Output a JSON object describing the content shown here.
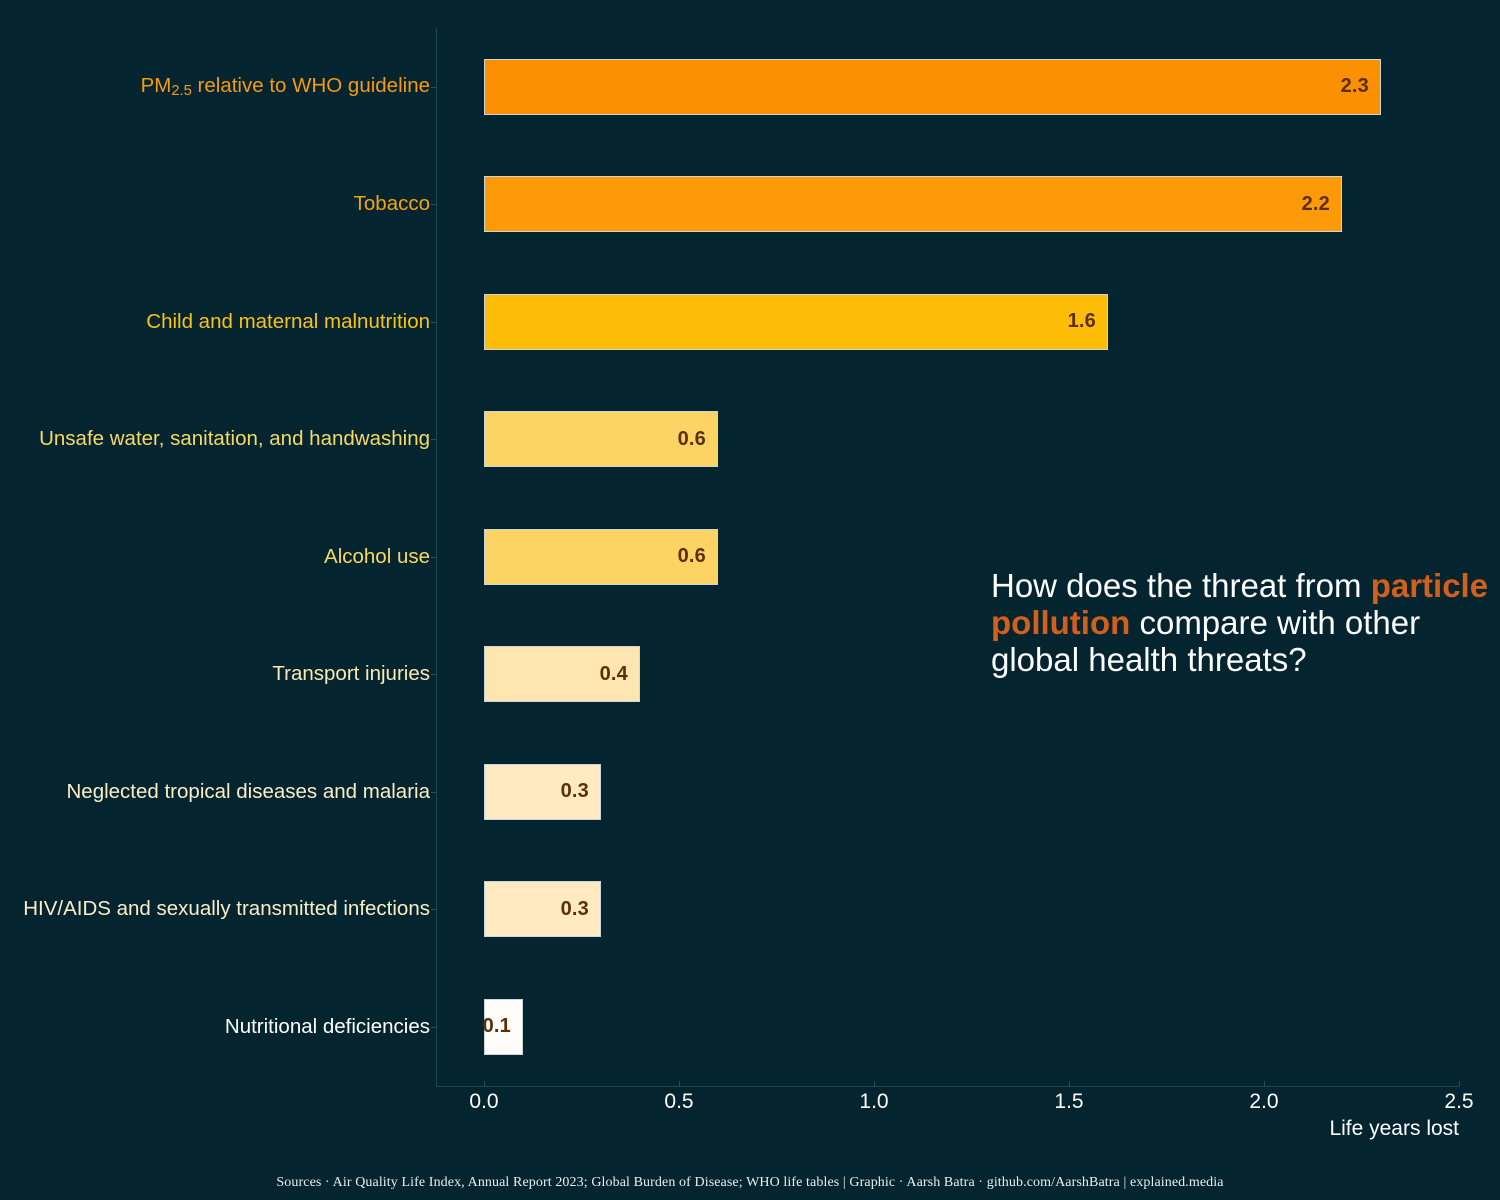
{
  "chart_data": {
    "type": "bar",
    "orientation": "horizontal",
    "title": "",
    "xlabel": "Life years lost",
    "ylabel": "",
    "xlim": [
      0.0,
      2.5
    ],
    "xticks": [
      "0.0",
      "0.5",
      "1.0",
      "1.5",
      "2.0",
      "2.5"
    ],
    "xtick_values": [
      0.0,
      0.5,
      1.0,
      1.5,
      2.0,
      2.5
    ],
    "grid": false,
    "legend": null,
    "categories": [
      "PM2.5 relative to WHO guideline",
      "Tobacco",
      "Child and maternal malnutrition",
      "Unsafe water, sanitation, and handwashing",
      "Alcohol use",
      "Transport injuries",
      "Neglected tropical diseases and malaria",
      "HIV/AIDS and sexually transmitted infections",
      "Nutritional deficiencies"
    ],
    "values": [
      2.3,
      2.2,
      1.6,
      0.6,
      0.6,
      0.4,
      0.3,
      0.3,
      0.1
    ],
    "value_labels": [
      "2.3",
      "2.2",
      "1.6",
      "0.6",
      "0.6",
      "0.4",
      "0.3",
      "0.3",
      "0.1"
    ],
    "bar_colors": [
      "#fc9003",
      "#fc9a08",
      "#fcbc08",
      "#fdd464",
      "#fdd464",
      "#ffe5af",
      "#ffeac1",
      "#ffeac1",
      "#fffdfa"
    ],
    "label_colors": [
      "#f59a11",
      "#f5a311",
      "#f9c218",
      "#f7d964",
      "#f7d964",
      "#fbeab3",
      "#fbeec4",
      "#fbeec4",
      "#ffffff"
    ]
  },
  "rows": [
    {
      "label_html": "PM<sub>2.5</sub> relative to WHO guideline",
      "label": "PM2.5 relative to WHO guideline",
      "value": 2.3,
      "value_label": "2.3",
      "bar_color": "#fc9003",
      "label_color": "#f59a11"
    },
    {
      "label_html": "Tobacco",
      "label": "Tobacco",
      "value": 2.2,
      "value_label": "2.2",
      "bar_color": "#fc9a08",
      "label_color": "#f5a311"
    },
    {
      "label_html": "Child and maternal malnutrition",
      "label": "Child and maternal malnutrition",
      "value": 1.6,
      "value_label": "1.6",
      "bar_color": "#fcbc08",
      "label_color": "#f9c218"
    },
    {
      "label_html": "Unsafe water, sanitation, and handwashing",
      "label": "Unsafe water, sanitation, and handwashing",
      "value": 0.6,
      "value_label": "0.6",
      "bar_color": "#fdd464",
      "label_color": "#f7d964"
    },
    {
      "label_html": "Alcohol use",
      "label": "Alcohol use",
      "value": 0.6,
      "value_label": "0.6",
      "bar_color": "#fdd464",
      "label_color": "#f7d964"
    },
    {
      "label_html": "Transport injuries",
      "label": "Transport injuries",
      "value": 0.4,
      "value_label": "0.4",
      "bar_color": "#ffe5af",
      "label_color": "#fbeab3"
    },
    {
      "label_html": "Neglected tropical diseases and malaria",
      "label": "Neglected tropical diseases and malaria",
      "value": 0.3,
      "value_label": "0.3",
      "bar_color": "#ffeac1",
      "label_color": "#fbeec4"
    },
    {
      "label_html": "HIV/AIDS and sexually transmitted infections",
      "label": "HIV/AIDS and sexually transmitted infections",
      "value": 0.3,
      "value_label": "0.3",
      "bar_color": "#ffeac1",
      "label_color": "#fbeec4"
    },
    {
      "label_html": "Nutritional deficiencies",
      "label": "Nutritional deficiencies",
      "value": 0.1,
      "value_label": "0.1",
      "bar_color": "#fffdfa",
      "label_color": "#ffffff"
    }
  ],
  "axis": {
    "x_title": "Life years lost",
    "ticks": [
      "0.0",
      "0.5",
      "1.0",
      "1.5",
      "2.0",
      "2.5"
    ]
  },
  "annotation": {
    "line1": "How does the threat from ",
    "highlight": "particle pollution",
    "line2": " compare with other global health threats?",
    "highlight_color": "#d2601a"
  },
  "footer": {
    "text": "Sources · Air Quality Life Index, Annual Report 2023; Global Burden of Disease; WHO life tables | Graphic · Aarsh Batra · github.com/AarshBatra | explained.media"
  },
  "theme": {
    "background": "#04242f",
    "axis_color": "#1f4653",
    "value_text_color": "#5c2f08",
    "tick_text_color": "#ffffff"
  }
}
